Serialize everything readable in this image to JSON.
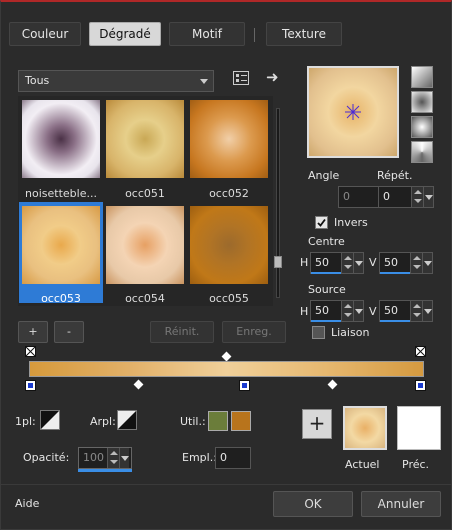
{
  "tabs": [
    {
      "label": "Couleur",
      "active": false
    },
    {
      "label": "Dégradé",
      "active": true
    },
    {
      "label": "Motif",
      "active": false
    },
    {
      "label": "Texture",
      "active": false
    }
  ],
  "category": {
    "selected": "Tous"
  },
  "gradients": [
    {
      "label": "noisetteble..."
    },
    {
      "label": "occ051"
    },
    {
      "label": "occ052"
    },
    {
      "label": "occ053",
      "selected": true
    },
    {
      "label": "occ054"
    },
    {
      "label": "occ055"
    }
  ],
  "list_buttons": {
    "add": "+",
    "remove": "-",
    "rename": "Réinit.",
    "save": "Enreg."
  },
  "angle": {
    "label": "Angle",
    "value": "0"
  },
  "repeat": {
    "label": "Répét.",
    "value": "0"
  },
  "invert": {
    "label": "Invers",
    "checked": true
  },
  "center": {
    "label": "Centre",
    "h_label": "H",
    "h_value": "50",
    "v_label": "V",
    "v_value": "50"
  },
  "source": {
    "label": "Source",
    "h_label": "H",
    "h_value": "50",
    "v_label": "V",
    "v_value": "50"
  },
  "link": {
    "label": "Liaison",
    "checked": false
  },
  "stops": {
    "left_label": "1pl:",
    "right_label": "Arpl:",
    "use_label": "Util.:",
    "opacity_label": "Opacité:",
    "opacity_value": "100",
    "position_label": "Empl.:",
    "position_value": "0",
    "color1": "#6b7d3a",
    "color2": "#b8741c"
  },
  "preview": {
    "current_label": "Actuel",
    "prev_label": "Préc.",
    "add": "+"
  },
  "footer": {
    "help": "Aide",
    "ok": "OK",
    "cancel": "Annuler"
  }
}
